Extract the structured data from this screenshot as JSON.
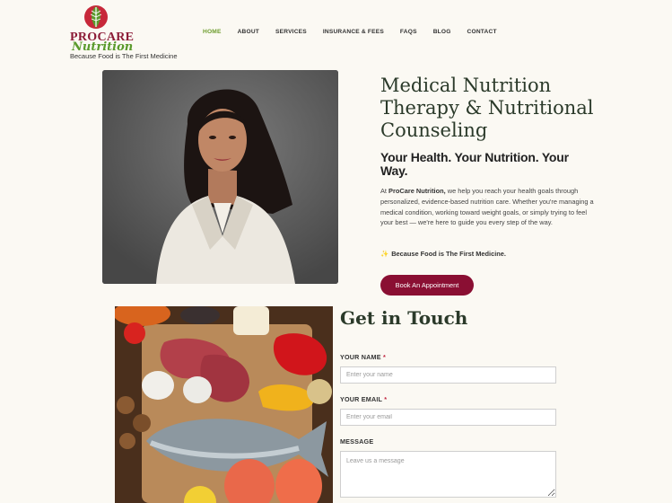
{
  "brand": {
    "name_top": "PROCARE",
    "name_bottom": "Nutrition",
    "tagline": "Because Food is The First Medicine",
    "logo_icon": "leaf-tomato-logo"
  },
  "nav": {
    "items": [
      {
        "label": "HOME",
        "active": true
      },
      {
        "label": "ABOUT"
      },
      {
        "label": "SERVICES"
      },
      {
        "label": "INSURANCE & FEES"
      },
      {
        "label": "FAQS"
      },
      {
        "label": "BLOG"
      },
      {
        "label": "CONTACT"
      }
    ]
  },
  "hero": {
    "title": "Medical Nutrition Therapy & Nutritional Counseling",
    "subtitle": "Your Health. Your Nutrition. Your Way.",
    "body_intro": "At ",
    "body_brand": "ProCare Nutrition,",
    "body_rest": " we help you reach your health goals through personalized, evidence-based nutrition care. Whether you're managing a medical condition, working toward weight goals, or simply trying to feel your best — we're here to guide you every step of the way.",
    "quote_icon": "sparkle-icon",
    "quote": "Because Food is The First Medicine.",
    "cta_label": "Book An Appointment"
  },
  "contact": {
    "title": "Get in Touch",
    "name_label": "YOUR NAME",
    "name_placeholder": "Enter your name",
    "email_label": "YOUR EMAIL",
    "email_placeholder": "Enter your email",
    "message_label": "MESSAGE",
    "message_placeholder": "Leave us a message",
    "required_mark": "*"
  },
  "colors": {
    "background": "#fbf9f3",
    "accent_burgundy": "#8a0f33",
    "nav_active_green": "#6e9d2e"
  }
}
